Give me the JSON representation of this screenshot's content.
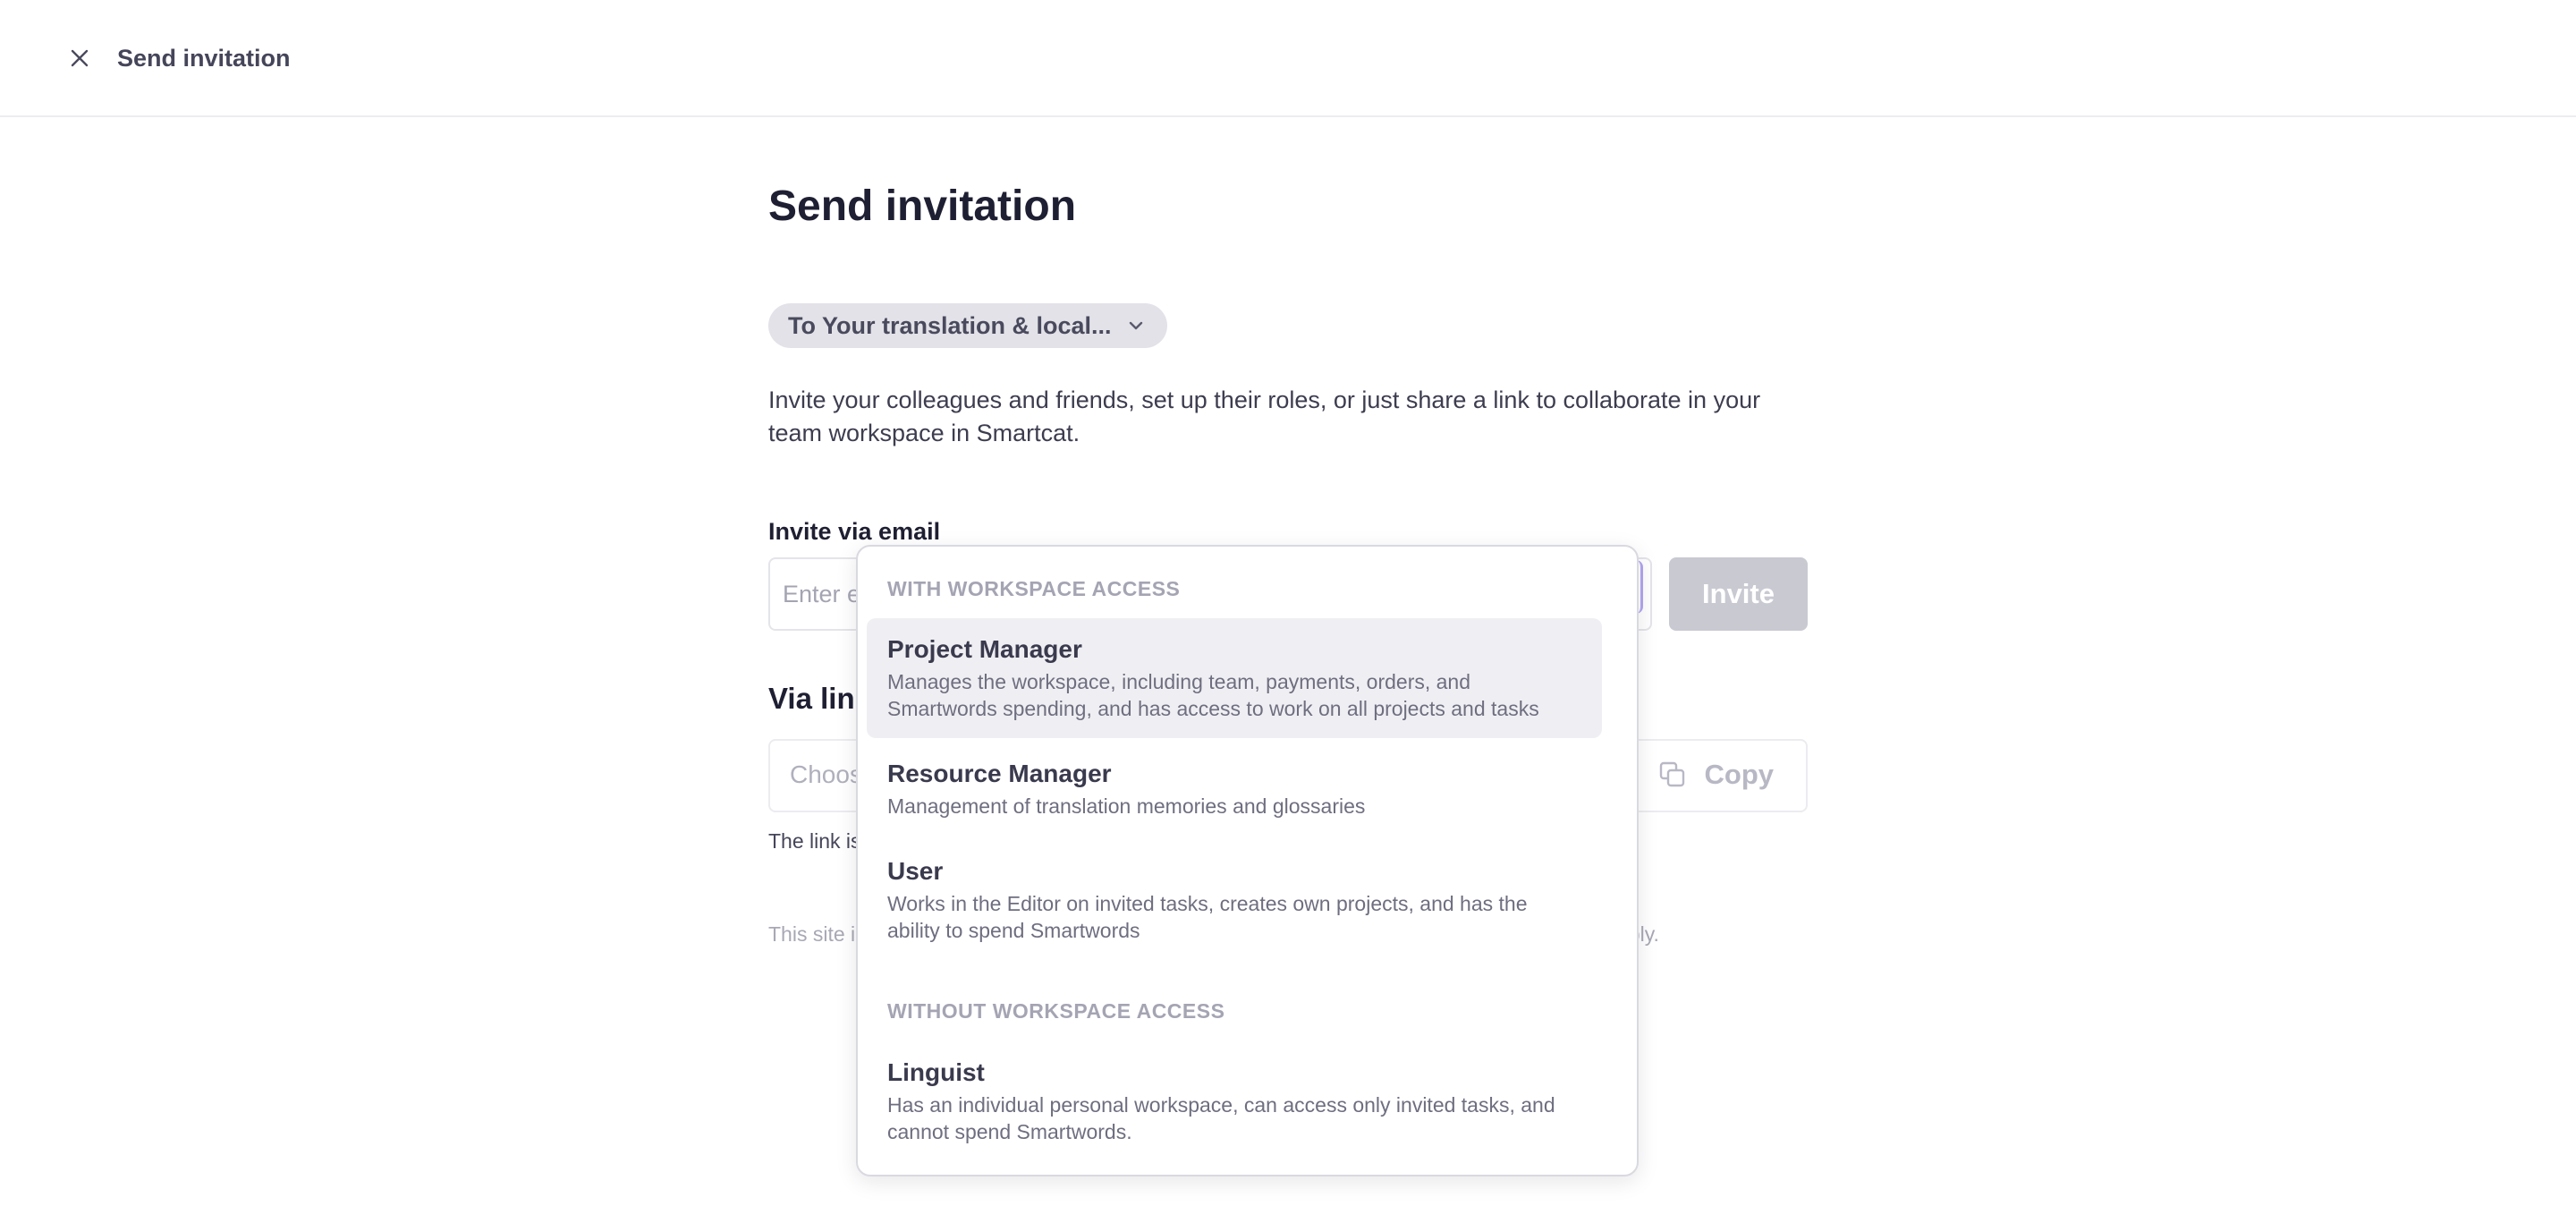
{
  "topbar": {
    "title": "Send invitation",
    "close_icon": "close-icon"
  },
  "page": {
    "title": "Send invitation",
    "workspace_selector": "To Your translation & local...",
    "description": "Invite your colleagues and friends, set up their roles, or just share a link to collaborate in your team workspace in Smartcat."
  },
  "invite_email": {
    "label": "Invite via email",
    "placeholder": "Enter e",
    "button_label": "Invite"
  },
  "invite_link": {
    "label": "Via link",
    "role_placeholder": "Choos",
    "copy_label": "Copy",
    "copy_icon": "copy-icon",
    "note": "The link is"
  },
  "footer": {
    "site_note_start": "This site i",
    "site_note_end": "pply."
  },
  "role_dropdown": {
    "groups": [
      {
        "heading": "WITH WORKSPACE ACCESS",
        "items": [
          {
            "name": "Project Manager",
            "description": "Manages the workspace, including team, payments, orders, and Smartwords spending, and has access to work on all projects and tasks",
            "highlighted": true
          },
          {
            "name": "Resource Manager",
            "description": "Management of translation memories and glossaries",
            "highlighted": false
          },
          {
            "name": "User",
            "description": "Works in the Editor on invited tasks, creates own projects, and has the ability to spend Smartwords",
            "highlighted": false
          }
        ]
      },
      {
        "heading": "WITHOUT WORKSPACE ACCESS",
        "items": [
          {
            "name": "Linguist",
            "description": "Has an individual personal workspace, can access only invited tasks, and cannot spend Smartwords.",
            "highlighted": false
          }
        ]
      }
    ]
  },
  "colors": {
    "text_primary": "#1f1f33",
    "muted": "#a4a4b3",
    "disabled_button": "#c9c9d2",
    "highlight_row": "#efeff3",
    "focus_accent": "#b3a6f0"
  }
}
